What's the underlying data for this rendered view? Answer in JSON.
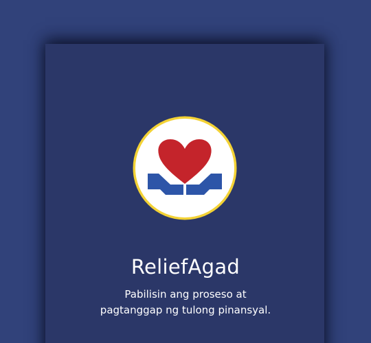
{
  "app": {
    "name": "ReliefAgad",
    "tagline_lines": [
      "Pabilisin ang proseso at",
      "pagtanggap ng tulong pinansyal."
    ]
  },
  "logo": {
    "icon": "heart-in-hands-icon",
    "colors": {
      "ring": "#f3d235",
      "background": "#ffffff",
      "heart": "#c4242b",
      "hands": "#2d55a8"
    }
  },
  "colors": {
    "page_background": "#31427a",
    "card_background": "#2b3768",
    "text": "#ffffff"
  }
}
